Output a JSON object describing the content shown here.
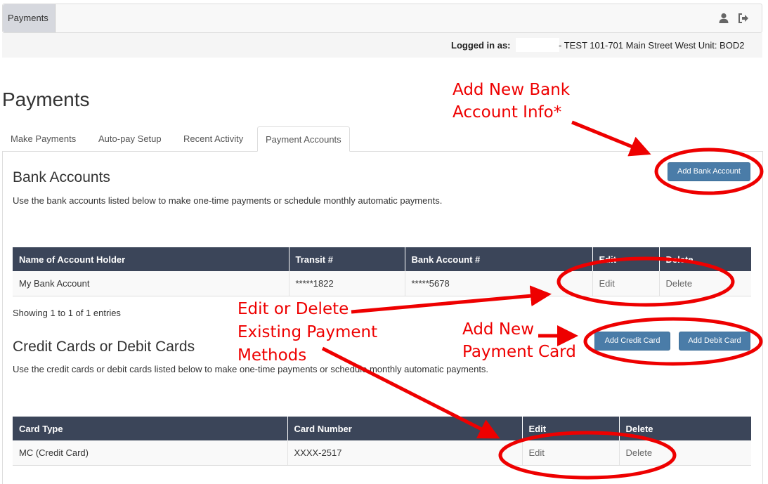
{
  "navbar": {
    "tab_label": "Payments",
    "icons": [
      "user-icon",
      "logout-icon"
    ]
  },
  "login": {
    "label": "Logged in as:",
    "detail": "- TEST 101-701 Main Street West Unit: BOD2"
  },
  "page_title": "Payments",
  "tabs": [
    {
      "label": "Make Payments"
    },
    {
      "label": "Auto-pay Setup"
    },
    {
      "label": "Recent Activity"
    },
    {
      "label": "Payment Accounts"
    }
  ],
  "bank": {
    "title": "Bank Accounts",
    "desc": "Use the bank accounts listed below to make one-time payments or schedule monthly automatic payments.",
    "add_button": "Add Bank Account",
    "headers": [
      "Name of Account Holder",
      "Transit #",
      "Bank Account #",
      "Edit",
      "Delete"
    ],
    "rows": [
      {
        "name": "My Bank Account",
        "transit": "*****1822",
        "account": "*****5678",
        "edit": "Edit",
        "delete": "Delete"
      }
    ],
    "showing": "Showing 1 to 1 of 1 entries"
  },
  "cards": {
    "title": "Credit Cards or Debit Cards",
    "desc": "Use the credit cards or debit cards listed below to make one-time payments or schedule monthly automatic payments.",
    "add_credit": "Add Credit Card",
    "add_debit": "Add Debit Card",
    "headers": [
      "Card Type",
      "Card Number",
      "Edit",
      "Delete"
    ],
    "rows": [
      {
        "type": "MC (Credit Card)",
        "number": "XXXX-2517",
        "edit": "Edit",
        "delete": "Delete"
      }
    ]
  },
  "annotations": {
    "add_bank_line1": "Add New Bank",
    "add_bank_line2": "Account Info*",
    "edit_delete_line1": "Edit or Delete",
    "edit_delete_line2": "Existing Payment",
    "edit_delete_line3": "Methods",
    "add_card_line1": "Add New",
    "add_card_line2": "Payment Card",
    "color": "#ee0000"
  },
  "colors": {
    "table_header": "#3b4559",
    "button": "#4a7ca8",
    "active_tab_bg": "#d6d8de"
  }
}
